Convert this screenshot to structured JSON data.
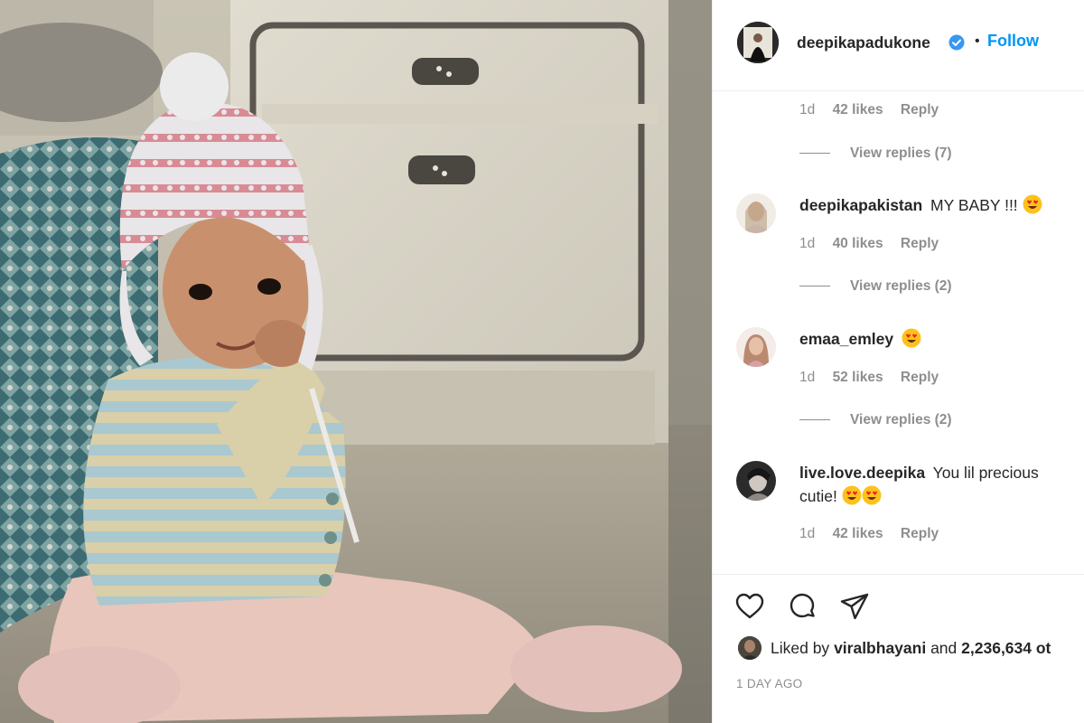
{
  "header": {
    "username": "deepikapadukone",
    "separator": "•",
    "follow_label": "Follow"
  },
  "comments": [
    {
      "id": "c0",
      "username": "",
      "text": "",
      "meta": {
        "time": "1d",
        "likes": "42 likes",
        "reply": "Reply"
      },
      "view_replies": "View replies (7)"
    },
    {
      "id": "c1",
      "username": "deepikapakistan",
      "text": "MY BABY !!!",
      "emoji": [
        "heart-eyes"
      ],
      "meta": {
        "time": "1d",
        "likes": "40 likes",
        "reply": "Reply"
      },
      "view_replies": "View replies (2)"
    },
    {
      "id": "c2",
      "username": "emaa_emley",
      "text": "",
      "emoji": [
        "heart-eyes"
      ],
      "meta": {
        "time": "1d",
        "likes": "52 likes",
        "reply": "Reply"
      },
      "view_replies": "View replies (2)"
    },
    {
      "id": "c3",
      "username": "live.love.deepika",
      "text": "You lil precious cutie!",
      "emoji": [
        "heart-eyes",
        "heart-eyes"
      ],
      "meta": {
        "time": "1d",
        "likes": "42 likes",
        "reply": "Reply"
      }
    }
  ],
  "actions": {
    "icons": [
      "heart-icon",
      "comment-icon",
      "share-icon"
    ]
  },
  "likes_summary": {
    "prefix": "Liked by",
    "user": "viralbhayani",
    "middle": "and",
    "count": "2,236,634 ot"
  },
  "timestamp": "1 DAY AGO",
  "colors": {
    "follow": "#0095f6",
    "secondary_text": "#8e8e8e",
    "primary_text": "#262626",
    "verified": "#3897f0"
  }
}
